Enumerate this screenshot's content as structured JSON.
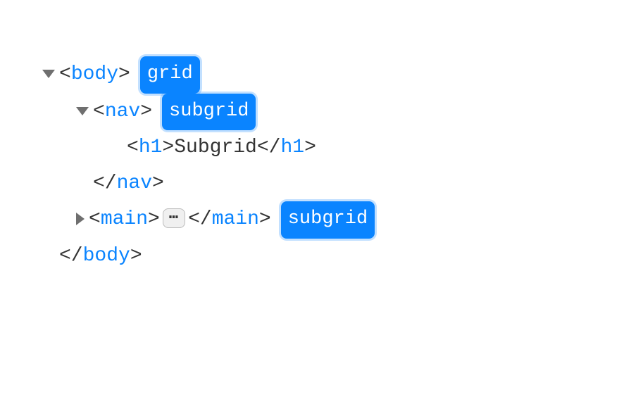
{
  "tree": {
    "body": {
      "open": "body",
      "badge": "grid",
      "close": "body"
    },
    "nav": {
      "open": "nav",
      "badge": "subgrid",
      "close": "nav"
    },
    "h1": {
      "open": "h1",
      "text": "Subgrid",
      "close": "h1"
    },
    "main": {
      "open": "main",
      "ellipsis": "⋯",
      "close": "main",
      "badge": "subgrid"
    }
  }
}
